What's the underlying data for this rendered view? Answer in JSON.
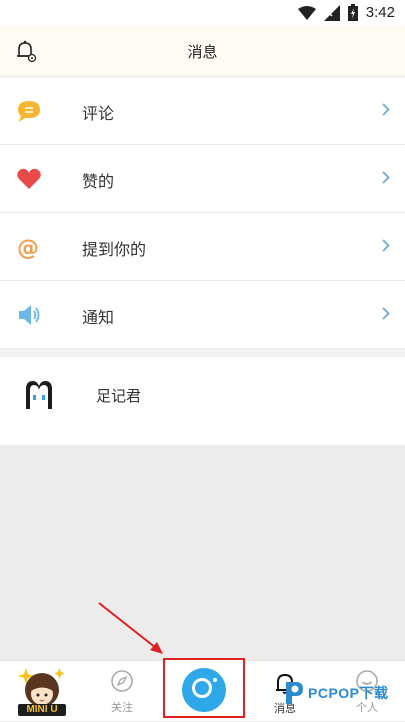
{
  "status_bar": {
    "time": "3:42"
  },
  "header": {
    "title": "消息"
  },
  "menu": [
    {
      "label": "评论",
      "icon": "comment-bubble-icon",
      "color": "#f5b731"
    },
    {
      "label": "赞的",
      "icon": "heart-icon",
      "color": "#e84a4a"
    },
    {
      "label": "提到你的",
      "icon": "at-sign-icon",
      "color": "#f0a050"
    },
    {
      "label": "通知",
      "icon": "speaker-icon",
      "color": "#6ab8e8"
    }
  ],
  "account": {
    "name": "足记君"
  },
  "tabbar": {
    "mini_label": "MINI U",
    "follow_label": "关注",
    "message_label": "消息",
    "me_label": "个人"
  },
  "watermark": {
    "text": "PCPOP下载"
  },
  "colors": {
    "accent_blue": "#2ea8e8",
    "chevron": "#6aaad4",
    "highlight_red": "#e02020"
  }
}
